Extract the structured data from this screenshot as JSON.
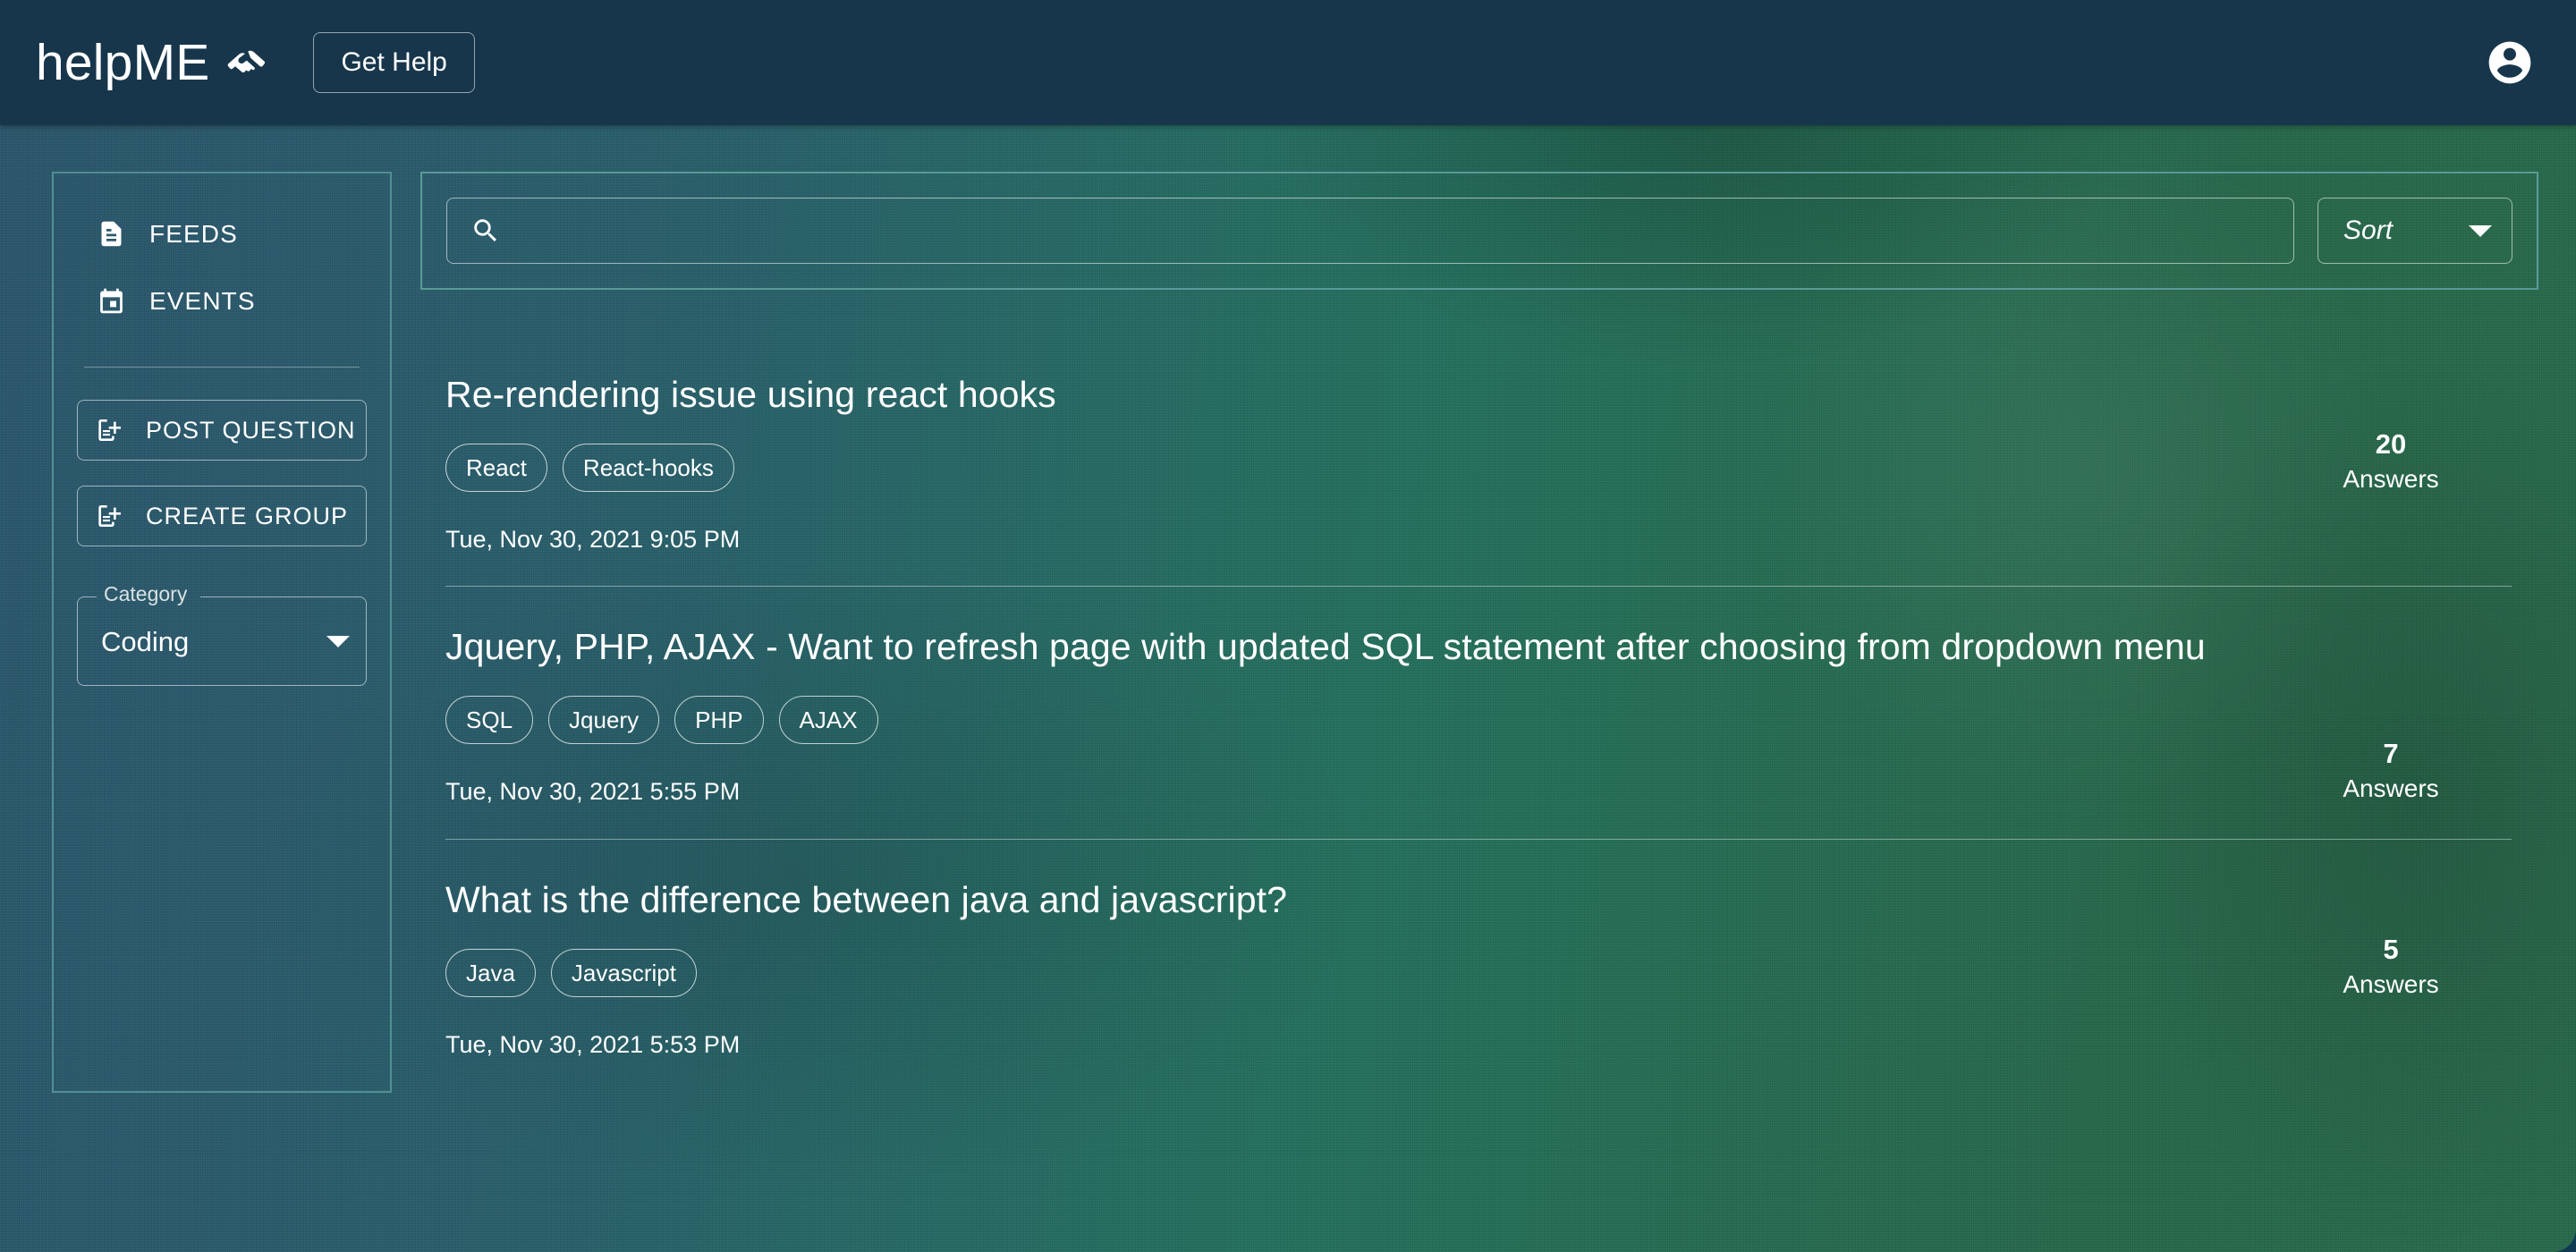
{
  "header": {
    "brand": "helpME",
    "brand_icon": "handshake-icon",
    "get_help_label": "Get Help",
    "account_icon": "account-circle-icon",
    "background_color": "#17364b"
  },
  "sidebar": {
    "nav": [
      {
        "label": "FEEDS",
        "icon": "article-icon"
      },
      {
        "label": "EVENTS",
        "icon": "calendar-icon"
      }
    ],
    "buttons": [
      {
        "label": "POST QUESTION",
        "icon": "post-add-icon"
      },
      {
        "label": "CREATE GROUP",
        "icon": "post-add-icon"
      }
    ],
    "category_select": {
      "legend": "Category",
      "value": "Coding",
      "icon": "chevron-down-icon"
    },
    "border_color": "#4f8f92"
  },
  "search": {
    "icon": "search-icon",
    "value": "",
    "placeholder": "",
    "sort_label": "Sort",
    "sort_icon": "chevron-down-icon",
    "border_color": "#5a9a98"
  },
  "posts": [
    {
      "title": "Re-rendering issue using react hooks",
      "tags": [
        "React",
        "React-hooks"
      ],
      "date": "Tue, Nov 30, 2021 9:05 PM",
      "answers_count": "20",
      "answers_label": "Answers"
    },
    {
      "title": "Jquery, PHP, AJAX - Want to refresh page with updated SQL statement after choosing from dropdown menu",
      "tags": [
        "SQL",
        "Jquery",
        "PHP",
        "AJAX"
      ],
      "date": "Tue, Nov 30, 2021 5:55 PM",
      "answers_count": "7",
      "answers_label": "Answers"
    },
    {
      "title": "What is the difference between java and javascript?",
      "tags": [
        "Java",
        "Javascript"
      ],
      "date": "Tue, Nov 30, 2021 5:53 PM",
      "answers_count": "5",
      "answers_label": "Answers"
    }
  ],
  "theme": {
    "background_left": "#2a566b",
    "background_right": "#276a4c",
    "text": "#ffffff"
  }
}
